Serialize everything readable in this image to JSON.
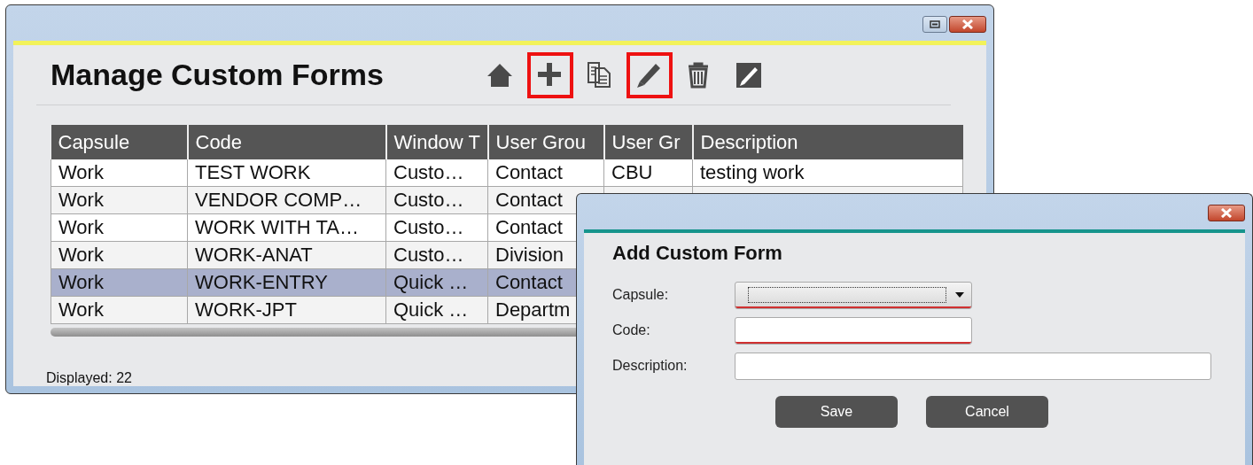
{
  "main_window": {
    "title": "Manage Custom Forms",
    "toolbar": [
      {
        "kind": "home",
        "highlighted": false
      },
      {
        "kind": "add",
        "highlighted": true
      },
      {
        "kind": "copy",
        "highlighted": false
      },
      {
        "kind": "edit",
        "highlighted": true
      },
      {
        "kind": "delete",
        "highlighted": false
      },
      {
        "kind": "edit-box",
        "highlighted": false
      }
    ],
    "table": {
      "columns": [
        "Capsule",
        "Code",
        "Window T",
        "User Grou",
        "User Gr",
        "Description"
      ],
      "rows": [
        {
          "cells": [
            "Work",
            "TEST WORK",
            "Custo…",
            "Contact",
            "CBU",
            "testing work"
          ],
          "selected": false
        },
        {
          "cells": [
            "Work",
            "VENDOR COMP…",
            "Custo…",
            "Contact"
          ],
          "selected": false
        },
        {
          "cells": [
            "Work",
            "WORK WITH TA…",
            "Custo…",
            "Contact"
          ],
          "selected": false
        },
        {
          "cells": [
            "Work",
            "WORK-ANAT",
            "Custo…",
            "Division"
          ],
          "selected": false
        },
        {
          "cells": [
            "Work",
            "WORK-ENTRY",
            "Quick …",
            "Contact"
          ],
          "selected": true
        },
        {
          "cells": [
            "Work",
            "WORK-JPT",
            "Quick …",
            "Departm"
          ],
          "selected": false
        }
      ]
    },
    "status": "Displayed: 22"
  },
  "dialog": {
    "title": "Add Custom Form",
    "fields": [
      {
        "label": "Capsule:",
        "kind": "dropdown",
        "required": true
      },
      {
        "label": "Code:",
        "kind": "text",
        "required": true
      },
      {
        "label": "Description:",
        "kind": "text-wide",
        "required": false
      }
    ],
    "buttons": [
      "Save",
      "Cancel"
    ]
  }
}
